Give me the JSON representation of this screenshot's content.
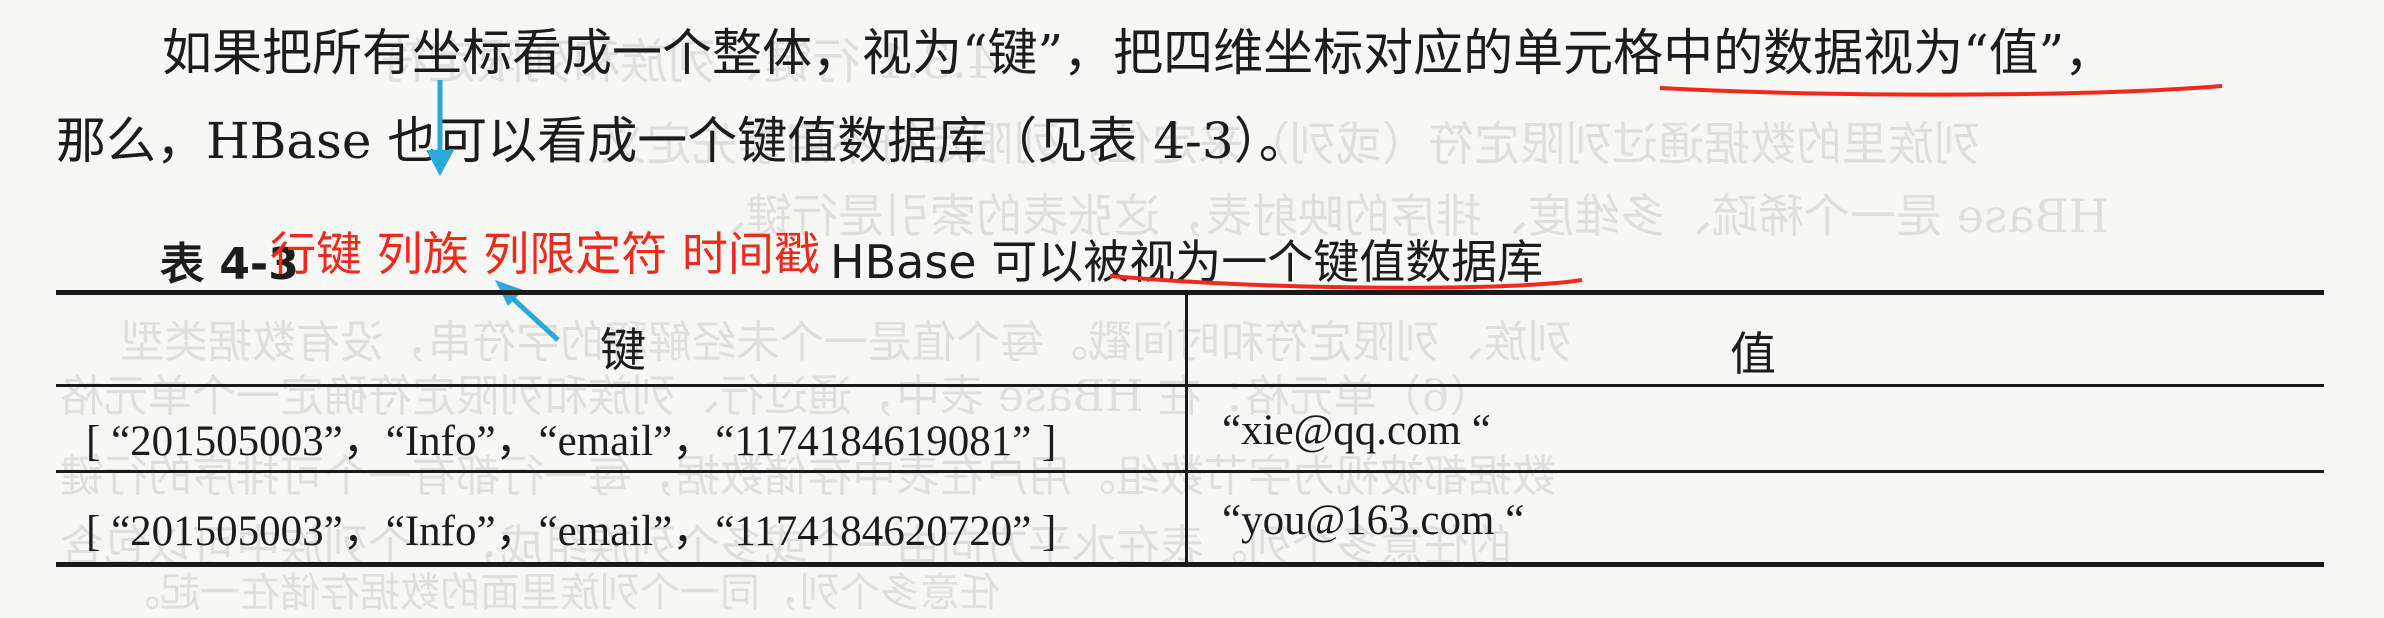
{
  "paragraph": {
    "line1": "如果把所有坐标看成一个整体，视为“键”，把四维坐标对应的单元格中的数据视为“值”，",
    "line2": "那么，HBase 也可以看成一个键值数据库（见表 4-3）。"
  },
  "annotation": {
    "label": "行键 列族 列限定符 时间戳",
    "color": "#f0291a"
  },
  "caption": {
    "number": "表 4-3",
    "title": "HBase 可以被视为一个键值数据库"
  },
  "table": {
    "headers": [
      "键",
      "值"
    ],
    "rows": [
      {
        "key": "[ “201505003”，“Info”，“email”，“1174184619081” ]",
        "value": "“xie@qq.com “"
      },
      {
        "key": "[ “201505003”，“Info”，“email”，“1174184620720” ]",
        "value": "“you@163.com “"
      }
    ]
  },
  "bleed_through": [
    "4.3.1 行键、列族和列限定符",
    "列族里的数据通过列限定符（或列）来定位，列限定符不用事先定义",
    "HBase 是一个稀疏、多维度、排序的映射表，这张表的索引是行键、",
    "列族、列限定符和时间戳。每个值是一个未经解释的字符串，没有数据类型",
    "（6）单元格：在 HBase 表中，通过行、列族和列限定符确定一个单元格",
    "数据都被视为字节数组。用户在表中存储数据，每一行都有一个可排序的行键",
    "的任意多个列。表在水平方向由一个或多个列族组成，一个列族中可以包含",
    "任意多个列，同一个列族里面的数据存储在一起。"
  ]
}
